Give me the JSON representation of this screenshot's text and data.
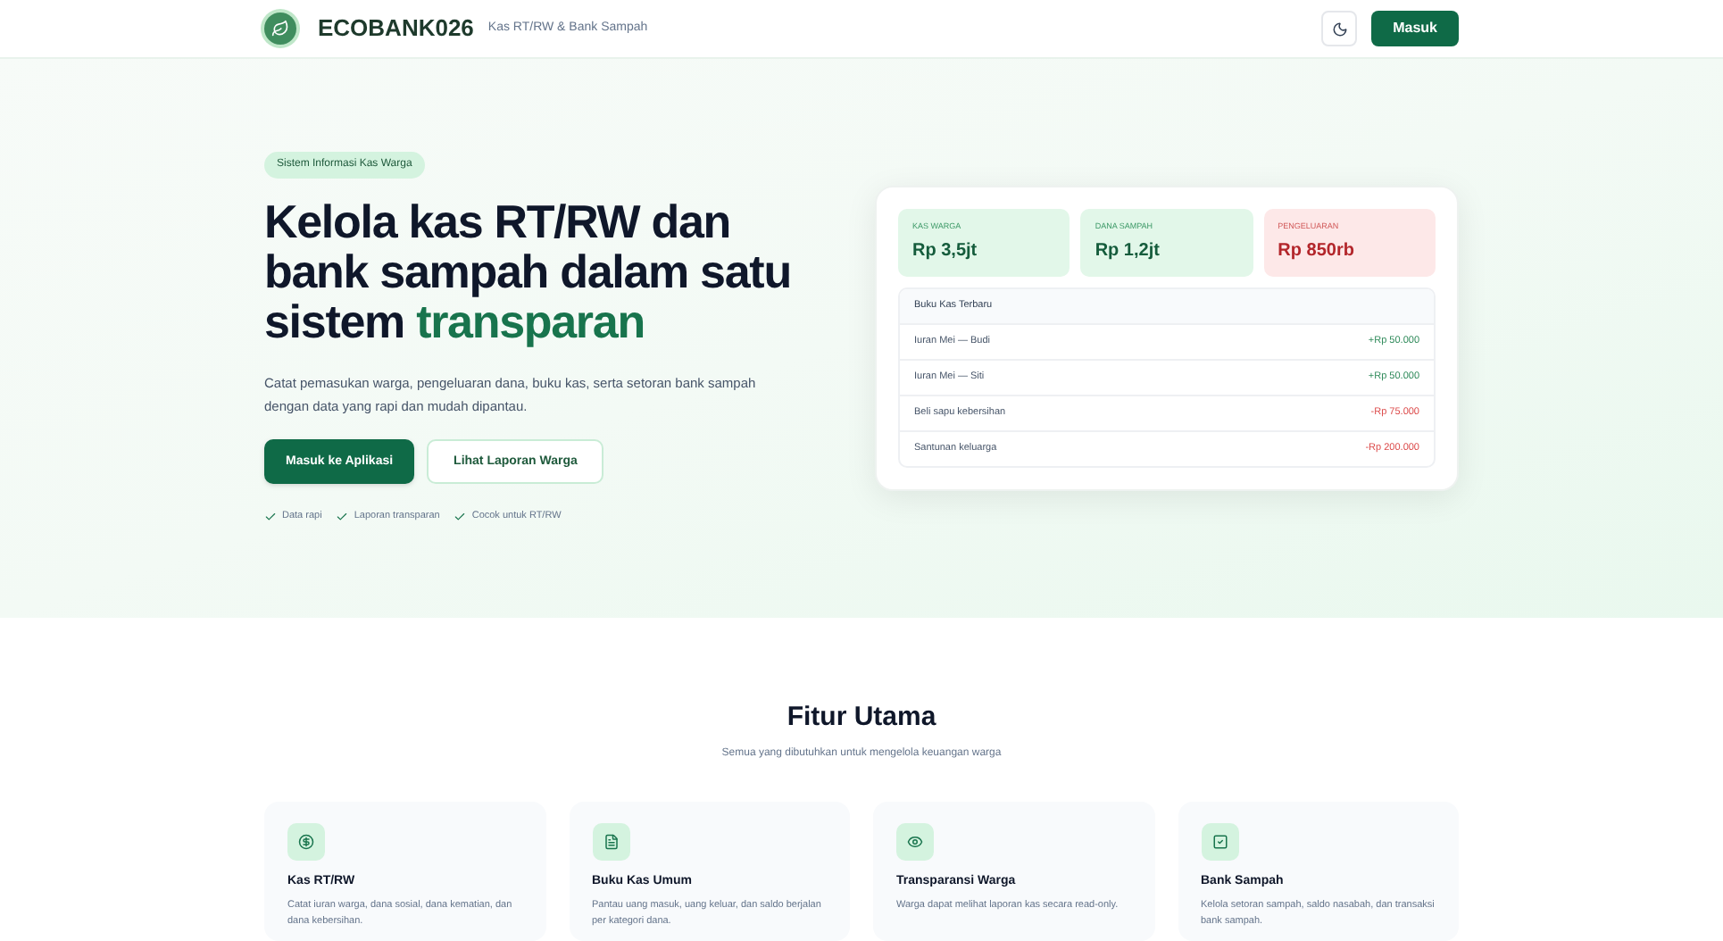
{
  "nav": {
    "brand": "ECOBANK026",
    "tagline": "Kas RT/RW & Bank Sampah",
    "login": "Masuk"
  },
  "hero": {
    "badge": "Sistem Informasi Kas Warga",
    "headline": "Kelola kas RT/RW dan bank sampah dalam satu sistem",
    "headline_highlight": "transparan",
    "description": "Catat pemasukan warga, pengeluaran dana, buku kas, serta setoran bank sampah dengan data yang rapi dan mudah dipantau.",
    "primary_button": "Masuk ke Aplikasi",
    "secondary_button": "Lihat Laporan Warga",
    "checks": [
      "Data rapi",
      "Laporan transparan",
      "Cocok untuk RT/RW"
    ]
  },
  "summary": {
    "stats": [
      {
        "label": "KAS WARGA",
        "value": "Rp 3,5jt",
        "kind": "income"
      },
      {
        "label": "DANA SAMPAH",
        "value": "Rp 1,2jt",
        "kind": "income"
      },
      {
        "label": "PENGELUARAN",
        "value": "Rp 850rb",
        "kind": "expense"
      }
    ],
    "ledger_title": "Buku Kas Terbaru",
    "ledger": [
      {
        "description": "Iuran Mei — Budi",
        "amount": "+Rp 50.000",
        "kind": "income"
      },
      {
        "description": "Iuran Mei — Siti",
        "amount": "+Rp 50.000",
        "kind": "income"
      },
      {
        "description": "Beli sapu kebersihan",
        "amount": "-Rp 75.000",
        "kind": "expense"
      },
      {
        "description": "Santunan keluarga",
        "amount": "-Rp 200.000",
        "kind": "expense"
      }
    ]
  },
  "features": {
    "title": "Fitur Utama",
    "subtitle": "Semua yang dibutuhkan untuk mengelola keuangan warga",
    "items": [
      {
        "title": "Kas RT/RW",
        "description": "Catat iuran warga, dana sosial, dana kematian, dan dana kebersihan.",
        "kind": "money"
      },
      {
        "title": "Buku Kas Umum",
        "description": "Pantau uang masuk, uang keluar, dan saldo berjalan per kategori dana.",
        "kind": "book"
      },
      {
        "title": "Transparansi Warga",
        "description": "Warga dapat melihat laporan kas secara read-only.",
        "kind": "eye"
      },
      {
        "title": "Bank Sampah",
        "description": "Kelola setoran sampah, saldo nasabah, dan transaksi bank sampah.",
        "kind": "box"
      }
    ]
  }
}
